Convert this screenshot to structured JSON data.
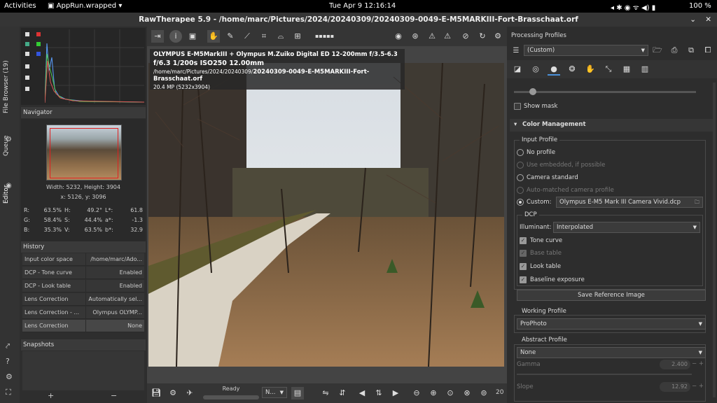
{
  "system_bar": {
    "activities": "Activities",
    "app_name": "AppRun.wrapped",
    "clock": "Tue Apr 9  12:16:14",
    "battery": "100 %"
  },
  "window": {
    "title": "RawTherapee 5.9 - /home/marc/Pictures/2024/20240309/20240309-0049-E-M5MARKIII-Fort-Brasschaat.orf"
  },
  "side_tabs": {
    "file_browser": "File Browser (19)",
    "queue": "Queue",
    "editor": "Editor"
  },
  "navigator": {
    "title": "Navigator",
    "size_label": "Width: 5232, Height: 3904",
    "coords_label": "x: 5126, y: 3096",
    "readouts": [
      {
        "k": "R:",
        "v": "63.5%"
      },
      {
        "k": "H:",
        "v": "49.2°"
      },
      {
        "k": "L*:",
        "v": "61.8"
      },
      {
        "k": "G:",
        "v": "58.4%"
      },
      {
        "k": "S:",
        "v": "44.4%"
      },
      {
        "k": "a*:",
        "v": "-1.3"
      },
      {
        "k": "B:",
        "v": "35.3%"
      },
      {
        "k": "V:",
        "v": "63.5%"
      },
      {
        "k": "b*:",
        "v": "32.9"
      }
    ]
  },
  "history": {
    "title": "History",
    "rows": [
      {
        "k": "Input color space",
        "v": "/home/marc/Ado..."
      },
      {
        "k": "DCP - Tone curve",
        "v": "Enabled"
      },
      {
        "k": "DCP - Look table",
        "v": "Enabled"
      },
      {
        "k": "Lens Correction",
        "v": "Automatically sel..."
      },
      {
        "k": "Lens Correction - ...",
        "v": "Olympus OLYMP..."
      },
      {
        "k": "Lens Correction",
        "v": "None"
      }
    ]
  },
  "snapshots": {
    "title": "Snapshots",
    "add": "+",
    "remove": "−"
  },
  "info": {
    "camera": "OLYMPUS E-M5MarkIII + Olympus M.Zuiko Digital ED 12-200mm f/3.5-6.3",
    "exposure": "f/6.3  1/200s  ISO250  12.00mm",
    "path_dir": "/home/marc/Pictures/2024/20240309/",
    "path_file": "20240309-0049-E-M5MARKIII-Fort-Brasschaat.orf",
    "resolution": "20.4 MP (5232x3904)"
  },
  "status": {
    "ready": "Ready",
    "zoom": "20",
    "mode_combo": "N..."
  },
  "right": {
    "title": "Processing Profiles",
    "profile": "(Custom)",
    "show_mask": "Show mask",
    "color_mgmt": "Color Management",
    "input_profile": {
      "title": "Input Profile",
      "no_profile": "No profile",
      "use_embedded": "Use embedded, if possible",
      "camera_standard": "Camera standard",
      "auto_matched": "Auto-matched camera profile",
      "custom": "Custom:",
      "custom_file": "Olympus E-M5 Mark III Camera Vivid.dcp"
    },
    "dcp": {
      "title": "DCP",
      "illuminant_label": "Illuminant:",
      "illuminant": "Interpolated",
      "tone_curve": "Tone curve",
      "base_table": "Base table",
      "look_table": "Look table",
      "baseline_exposure": "Baseline exposure"
    },
    "save_ref": "Save Reference Image",
    "working_profile": {
      "title": "Working Profile",
      "value": "ProPhoto"
    },
    "abstract_profile": {
      "title": "Abstract Profile",
      "value": "None",
      "gamma_label": "Gamma",
      "gamma_value": "2.400",
      "slope_label": "Slope",
      "slope_value": "12.92"
    }
  }
}
